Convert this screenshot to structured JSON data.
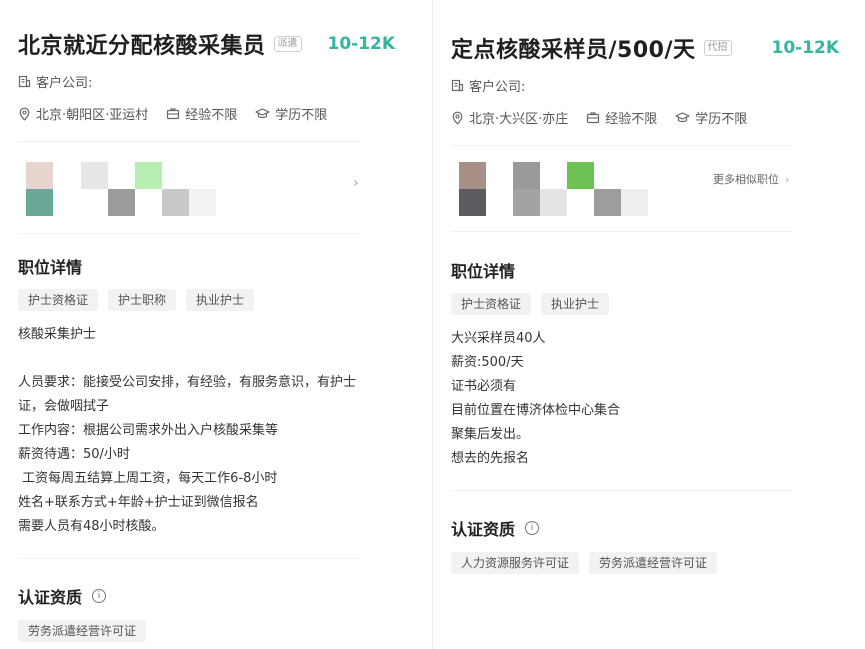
{
  "left": {
    "title": "北京就近分配核酸采集员",
    "badge": "派遣",
    "salary": "10-12K",
    "client_label": "客户公司:",
    "location": "北京·朝阳区·亚运村",
    "experience": "经验不限",
    "education": "学历不限",
    "section_detail": "职位详情",
    "tags": [
      "护士资格证",
      "护士职称",
      "执业护士"
    ],
    "description": "核酸采集护士\n\n人员要求：能接受公司安排，有经验，有服务意识，有护士证，会做咽拭子\n工作内容：根据公司需求外出入户核酸采集等\n薪资待遇：50/小时\n 工资每周五结算上周工资，每天工作6-8小时\n姓名+联系方式+年龄+护士证到微信报名\n需要人员有48小时核酸。",
    "section_cert": "认证资质",
    "cert_tags": [
      "劳务派遣经营许可证"
    ]
  },
  "right": {
    "title": "定点核酸采样员/500/天",
    "badge": "代招",
    "salary": "10-12K",
    "client_label": "客户公司:",
    "location": "北京·大兴区·亦庄",
    "experience": "经验不限",
    "education": "学历不限",
    "more_similar": "更多相似职位",
    "section_detail": "职位详情",
    "tags": [
      "护士资格证",
      "执业护士"
    ],
    "description": "大兴采样员40人\n薪资:500/天\n证书必须有\n目前位置在博济体检中心集合\n聚集后发出。\n想去的先报名",
    "section_cert": "认证资质",
    "cert_tags": [
      "人力资源服务许可证",
      "劳务派遣经营许可证"
    ]
  },
  "icons": {
    "building": "building-icon",
    "location": "location-pin-icon",
    "experience": "briefcase-icon",
    "education": "graduation-cap-icon",
    "chevron": "chevron-right-icon",
    "info": "info-icon"
  },
  "colors": {
    "salary": "#33b5a0",
    "tag_bg": "#f2f2f2",
    "divider": "#ececec"
  }
}
